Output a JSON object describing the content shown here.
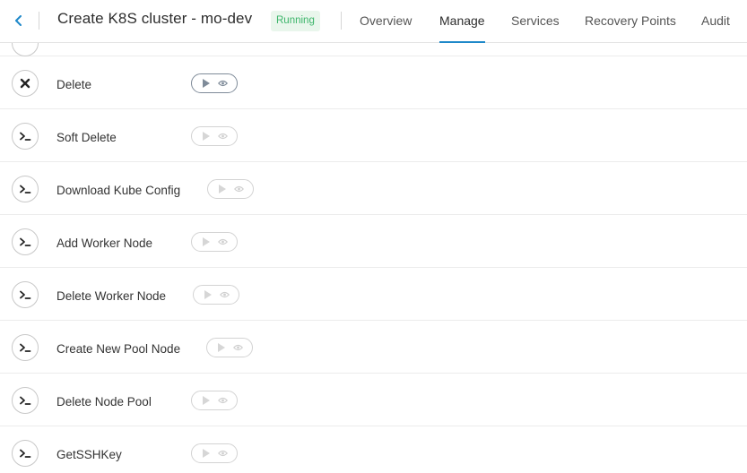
{
  "header": {
    "title": "Create K8S cluster - mo-dev",
    "status": "Running",
    "tabs": [
      {
        "label": "Overview"
      },
      {
        "label": "Manage"
      },
      {
        "label": "Services"
      },
      {
        "label": "Recovery Points"
      },
      {
        "label": "Audit"
      }
    ],
    "active_tab": "Manage"
  },
  "actions": [
    {
      "label": "Delete",
      "icon": "close-icon",
      "enabled": true
    },
    {
      "label": "Soft Delete",
      "icon": "terminal-icon",
      "enabled": false
    },
    {
      "label": "Download Kube Config",
      "icon": "terminal-icon",
      "enabled": false
    },
    {
      "label": "Add Worker Node",
      "icon": "terminal-icon",
      "enabled": false
    },
    {
      "label": "Delete Worker Node",
      "icon": "terminal-icon",
      "enabled": false
    },
    {
      "label": "Create New Pool Node",
      "icon": "terminal-icon",
      "enabled": false
    },
    {
      "label": "Delete Node Pool",
      "icon": "terminal-icon",
      "enabled": false
    },
    {
      "label": "GetSSHKey",
      "icon": "terminal-icon",
      "enabled": false
    }
  ],
  "colors": {
    "accent": "#1e88c9",
    "status_text": "#3cb56a",
    "status_bg": "#e9f6ec"
  }
}
